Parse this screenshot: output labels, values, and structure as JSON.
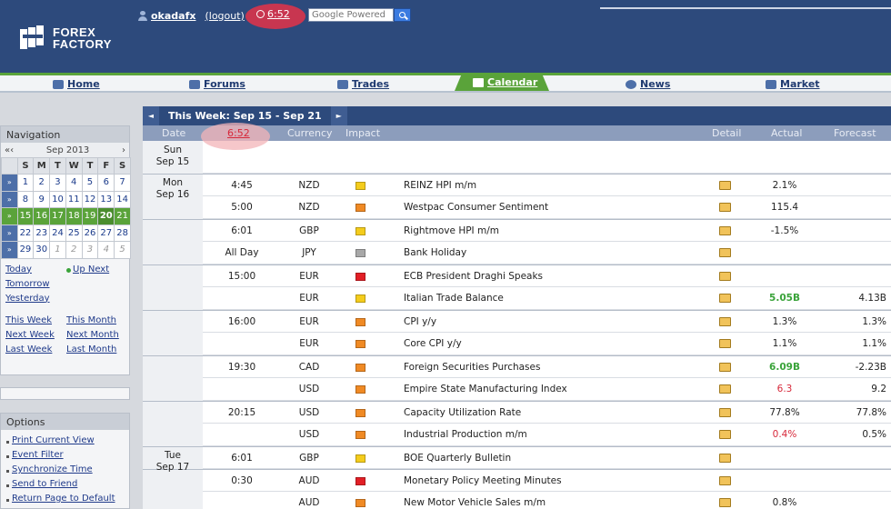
{
  "header": {
    "username": "okadafx",
    "logout_label": "(logout)",
    "clock": "6:52",
    "search_placeholder": "Google Powered",
    "logo_line1": "FOREX",
    "logo_line2": "FACTORY"
  },
  "nav": {
    "home": "Home",
    "forums": "Forums",
    "trades": "Trades",
    "calendar": "Calendar",
    "news": "News",
    "market": "Market"
  },
  "sidebar": {
    "navigation_title": "Navigation",
    "prev_year": "«",
    "prev_month": "‹",
    "month_label": "Sep 2013",
    "next_month": "›",
    "weekdays": [
      "S",
      "M",
      "T",
      "W",
      "T",
      "F",
      "S"
    ],
    "weeks": [
      [
        "1",
        "2",
        "3",
        "4",
        "5",
        "6",
        "7"
      ],
      [
        "8",
        "9",
        "10",
        "11",
        "12",
        "13",
        "14"
      ],
      [
        "15",
        "16",
        "17",
        "18",
        "19",
        "20",
        "21"
      ],
      [
        "22",
        "23",
        "24",
        "25",
        "26",
        "27",
        "28"
      ],
      [
        "29",
        "30",
        "1",
        "2",
        "3",
        "4",
        "5"
      ]
    ],
    "week_marker": "»",
    "links": {
      "today": "Today",
      "up_next": "Up Next",
      "tomorrow": "Tomorrow",
      "yesterday": "Yesterday",
      "this_week": "This Week",
      "this_month": "This Month",
      "next_week": "Next Week",
      "next_month": "Next Month",
      "last_week": "Last Week",
      "last_month": "Last Month"
    },
    "options_title": "Options",
    "options": [
      "Print Current View",
      "Event Filter",
      "Synchronize Time",
      "Send to Friend",
      "Return Page to Default"
    ]
  },
  "calendar": {
    "week_title": "This Week: Sep 15 - Sep 21",
    "prev_arrow": "◄",
    "next_arrow": "►",
    "columns": {
      "date": "Date",
      "time": "6:52",
      "currency": "Currency",
      "impact": "Impact",
      "detail": "Detail",
      "actual": "Actual",
      "forecast": "Forecast"
    },
    "days": [
      {
        "day": "Sun",
        "date": "Sep 15"
      },
      {
        "day": "Mon",
        "date": "Sep 16"
      },
      {
        "day": "Tue",
        "date": "Sep 17"
      }
    ],
    "impact_colors": {
      "low": "#f4cc1c",
      "medium": "#f08a24",
      "high": "#e21f26",
      "holiday": "#a8a8a8"
    },
    "events": [
      {
        "time": "4:45",
        "currency": "NZD",
        "impact": "low",
        "event": "REINZ HPI m/m",
        "actual": "2.1%",
        "forecast": ""
      },
      {
        "time": "5:00",
        "currency": "NZD",
        "impact": "medium",
        "event": "Westpac Consumer Sentiment",
        "actual": "115.4",
        "forecast": ""
      },
      {
        "time": "6:01",
        "currency": "GBP",
        "impact": "low",
        "event": "Rightmove HPI m/m",
        "actual": "-1.5%",
        "forecast": ""
      },
      {
        "time": "All Day",
        "currency": "JPY",
        "impact": "holiday",
        "event": "Bank Holiday",
        "actual": "",
        "forecast": ""
      },
      {
        "time": "15:00",
        "currency": "EUR",
        "impact": "high",
        "event": "ECB President Draghi Speaks",
        "actual": "",
        "forecast": ""
      },
      {
        "time": "",
        "currency": "EUR",
        "impact": "low",
        "event": "Italian Trade Balance",
        "actual": "5.05B",
        "forecast": "4.13B"
      },
      {
        "time": "16:00",
        "currency": "EUR",
        "impact": "medium",
        "event": "CPI y/y",
        "actual": "1.3%",
        "forecast": "1.3%"
      },
      {
        "time": "",
        "currency": "EUR",
        "impact": "medium",
        "event": "Core CPI y/y",
        "actual": "1.1%",
        "forecast": "1.1%"
      },
      {
        "time": "19:30",
        "currency": "CAD",
        "impact": "medium",
        "event": "Foreign Securities Purchases",
        "actual": "6.09B",
        "forecast": "-2.23B"
      },
      {
        "time": "",
        "currency": "USD",
        "impact": "medium",
        "event": "Empire State Manufacturing Index",
        "actual": "6.3",
        "forecast": "9.2"
      },
      {
        "time": "20:15",
        "currency": "USD",
        "impact": "medium",
        "event": "Capacity Utilization Rate",
        "actual": "77.8%",
        "forecast": "77.8%"
      },
      {
        "time": "",
        "currency": "USD",
        "impact": "medium",
        "event": "Industrial Production m/m",
        "actual": "0.4%",
        "forecast": "0.5%"
      },
      {
        "time": "6:01",
        "currency": "GBP",
        "impact": "low",
        "event": "BOE Quarterly Bulletin",
        "actual": "",
        "forecast": ""
      },
      {
        "time": "0:30",
        "currency": "AUD",
        "impact": "high",
        "event": "Monetary Policy Meeting Minutes",
        "actual": "",
        "forecast": ""
      },
      {
        "time": "",
        "currency": "AUD",
        "impact": "medium",
        "event": "New Motor Vehicle Sales m/m",
        "actual": "0.8%",
        "forecast": ""
      }
    ]
  }
}
